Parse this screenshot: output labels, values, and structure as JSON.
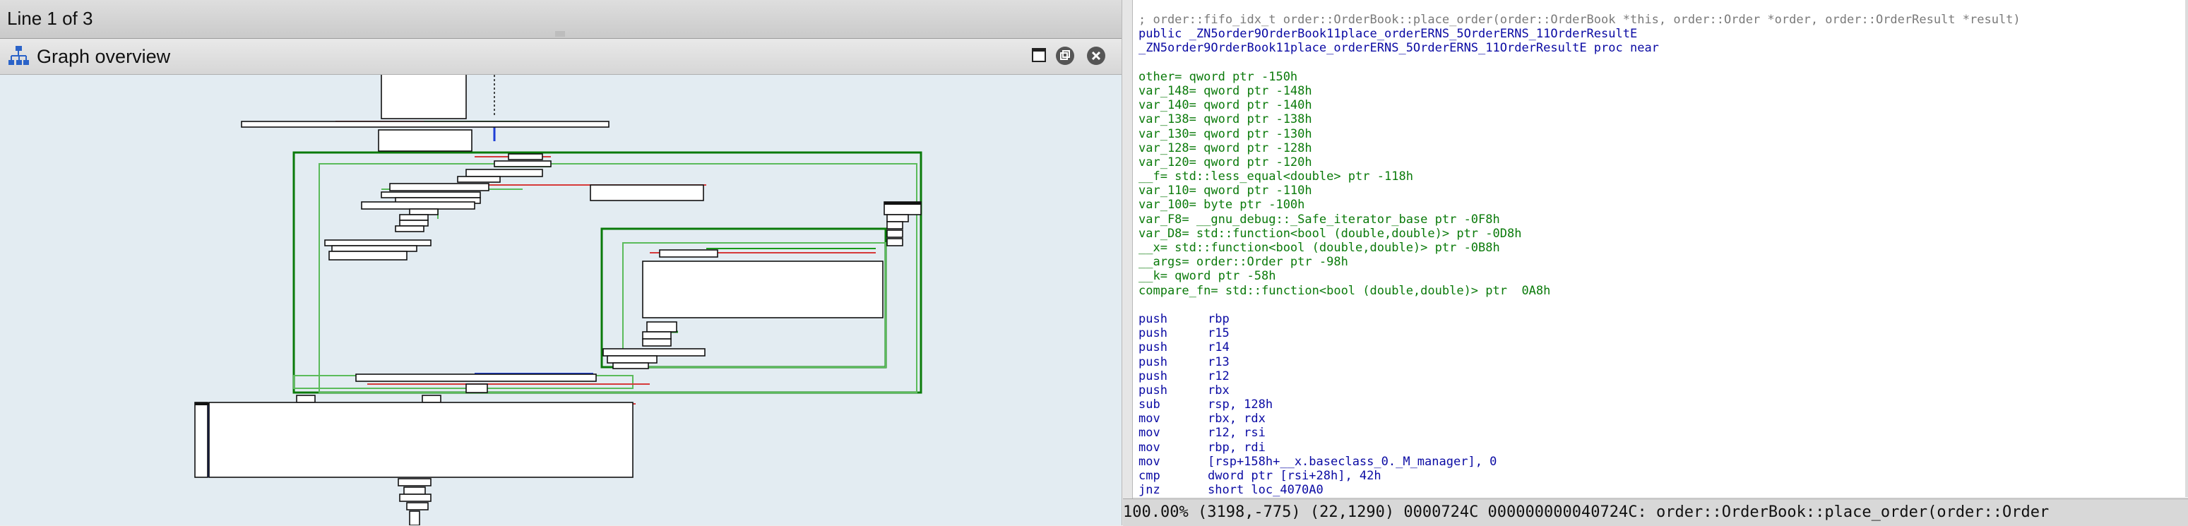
{
  "line_indicator": "Line 1 of 3",
  "graph_overview": {
    "title": "Graph overview",
    "buttons": [
      "restore-icon",
      "float-icon",
      "close-icon"
    ]
  },
  "disassembly": {
    "lines": [
      {
        "kind": "cmt",
        "text": "; order::fifo_idx_t order::OrderBook::place_order(order::OrderBook *this, order::Order *order, order::OrderResult *result)"
      },
      {
        "kind": "plain",
        "text": "public _ZN5order9OrderBook11place_orderERNS_5OrderERNS_11OrderResultE"
      },
      {
        "kind": "plain",
        "text": "_ZN5order9OrderBook11place_orderERNS_5OrderERNS_11OrderResultE proc near"
      },
      {
        "kind": "blank",
        "text": ""
      },
      {
        "kind": "var",
        "text": "other= qword ptr -150h"
      },
      {
        "kind": "var",
        "text": "var_148= qword ptr -148h"
      },
      {
        "kind": "var",
        "text": "var_140= qword ptr -140h"
      },
      {
        "kind": "var",
        "text": "var_138= qword ptr -138h"
      },
      {
        "kind": "var",
        "text": "var_130= qword ptr -130h"
      },
      {
        "kind": "var",
        "text": "var_128= qword ptr -128h"
      },
      {
        "kind": "var",
        "text": "var_120= qword ptr -120h"
      },
      {
        "kind": "var",
        "text": "__f= std::less_equal<double> ptr -118h"
      },
      {
        "kind": "var",
        "text": "var_110= qword ptr -110h"
      },
      {
        "kind": "var",
        "text": "var_100= byte ptr -100h"
      },
      {
        "kind": "var",
        "text": "var_F8= __gnu_debug::_Safe_iterator_base ptr -0F8h"
      },
      {
        "kind": "var",
        "text": "var_D8= std::function<bool (double,double)> ptr -0D8h"
      },
      {
        "kind": "var",
        "text": "__x= std::function<bool (double,double)> ptr -0B8h"
      },
      {
        "kind": "var",
        "text": "__args= order::Order ptr -98h"
      },
      {
        "kind": "var",
        "text": "__k= qword ptr -58h"
      },
      {
        "kind": "var",
        "text": "compare_fn= std::function<bool (double,double)> ptr  0A8h"
      },
      {
        "kind": "blank",
        "text": ""
      },
      {
        "kind": "ins",
        "mn": "push",
        "op": "rbp"
      },
      {
        "kind": "ins",
        "mn": "push",
        "op": "r15"
      },
      {
        "kind": "ins",
        "mn": "push",
        "op": "r14"
      },
      {
        "kind": "ins",
        "mn": "push",
        "op": "r13"
      },
      {
        "kind": "ins",
        "mn": "push",
        "op": "r12"
      },
      {
        "kind": "ins",
        "mn": "push",
        "op": "rbx"
      },
      {
        "kind": "ins",
        "mn": "sub",
        "op": "rsp, 128h"
      },
      {
        "kind": "ins",
        "mn": "mov",
        "op": "rbx, rdx"
      },
      {
        "kind": "ins",
        "mn": "mov",
        "op": "r12, rsi"
      },
      {
        "kind": "ins",
        "mn": "mov",
        "op": "rbp, rdi"
      },
      {
        "kind": "ins",
        "mn": "mov",
        "op": "[rsp+158h+__x.baseclass_0._M_manager], 0"
      },
      {
        "kind": "ins",
        "mn": "cmp",
        "op": "dword ptr [rsi+28h], 42h"
      },
      {
        "kind": "ins",
        "mn": "jnz",
        "op": "short loc_4070A0"
      }
    ]
  },
  "status_bar": "100.00% (3198,-775) (22,1290) 0000724C 000000000040724C: order::OrderBook::place_order(order::Order",
  "colors": {
    "true_edge": "#1a9a1a",
    "false_edge": "#d63a3a",
    "flow_edge": "#1f3fd6",
    "loop_frame": "#0a7a0a",
    "code_blue": "#0a0aa3",
    "code_green": "#0a7a0a",
    "comment_gray": "#7a7a7a"
  }
}
